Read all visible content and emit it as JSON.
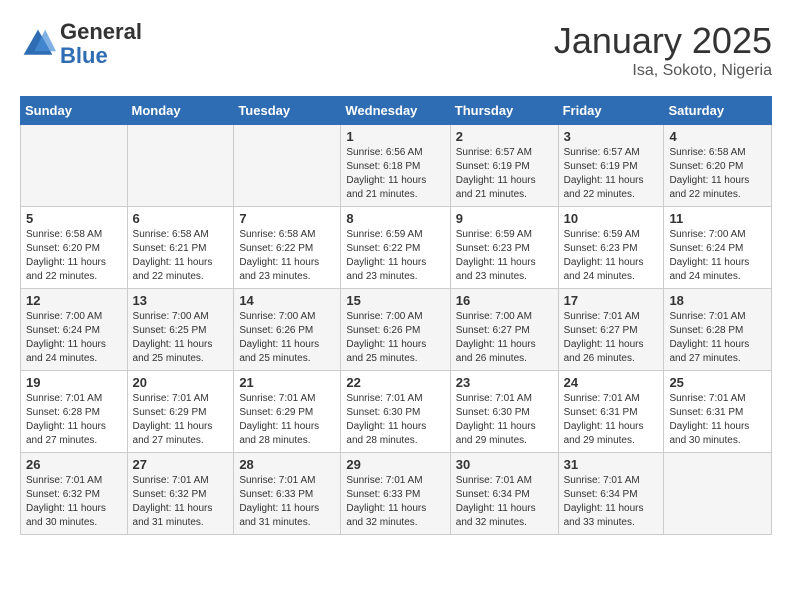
{
  "header": {
    "logo_general": "General",
    "logo_blue": "Blue",
    "month": "January 2025",
    "location": "Isa, Sokoto, Nigeria"
  },
  "days_of_week": [
    "Sunday",
    "Monday",
    "Tuesday",
    "Wednesday",
    "Thursday",
    "Friday",
    "Saturday"
  ],
  "weeks": [
    [
      {
        "day": "",
        "info": ""
      },
      {
        "day": "",
        "info": ""
      },
      {
        "day": "",
        "info": ""
      },
      {
        "day": "1",
        "info": "Sunrise: 6:56 AM\nSunset: 6:18 PM\nDaylight: 11 hours and 21 minutes."
      },
      {
        "day": "2",
        "info": "Sunrise: 6:57 AM\nSunset: 6:19 PM\nDaylight: 11 hours and 21 minutes."
      },
      {
        "day": "3",
        "info": "Sunrise: 6:57 AM\nSunset: 6:19 PM\nDaylight: 11 hours and 22 minutes."
      },
      {
        "day": "4",
        "info": "Sunrise: 6:58 AM\nSunset: 6:20 PM\nDaylight: 11 hours and 22 minutes."
      }
    ],
    [
      {
        "day": "5",
        "info": "Sunrise: 6:58 AM\nSunset: 6:20 PM\nDaylight: 11 hours and 22 minutes."
      },
      {
        "day": "6",
        "info": "Sunrise: 6:58 AM\nSunset: 6:21 PM\nDaylight: 11 hours and 22 minutes."
      },
      {
        "day": "7",
        "info": "Sunrise: 6:58 AM\nSunset: 6:22 PM\nDaylight: 11 hours and 23 minutes."
      },
      {
        "day": "8",
        "info": "Sunrise: 6:59 AM\nSunset: 6:22 PM\nDaylight: 11 hours and 23 minutes."
      },
      {
        "day": "9",
        "info": "Sunrise: 6:59 AM\nSunset: 6:23 PM\nDaylight: 11 hours and 23 minutes."
      },
      {
        "day": "10",
        "info": "Sunrise: 6:59 AM\nSunset: 6:23 PM\nDaylight: 11 hours and 24 minutes."
      },
      {
        "day": "11",
        "info": "Sunrise: 7:00 AM\nSunset: 6:24 PM\nDaylight: 11 hours and 24 minutes."
      }
    ],
    [
      {
        "day": "12",
        "info": "Sunrise: 7:00 AM\nSunset: 6:24 PM\nDaylight: 11 hours and 24 minutes."
      },
      {
        "day": "13",
        "info": "Sunrise: 7:00 AM\nSunset: 6:25 PM\nDaylight: 11 hours and 25 minutes."
      },
      {
        "day": "14",
        "info": "Sunrise: 7:00 AM\nSunset: 6:26 PM\nDaylight: 11 hours and 25 minutes."
      },
      {
        "day": "15",
        "info": "Sunrise: 7:00 AM\nSunset: 6:26 PM\nDaylight: 11 hours and 25 minutes."
      },
      {
        "day": "16",
        "info": "Sunrise: 7:00 AM\nSunset: 6:27 PM\nDaylight: 11 hours and 26 minutes."
      },
      {
        "day": "17",
        "info": "Sunrise: 7:01 AM\nSunset: 6:27 PM\nDaylight: 11 hours and 26 minutes."
      },
      {
        "day": "18",
        "info": "Sunrise: 7:01 AM\nSunset: 6:28 PM\nDaylight: 11 hours and 27 minutes."
      }
    ],
    [
      {
        "day": "19",
        "info": "Sunrise: 7:01 AM\nSunset: 6:28 PM\nDaylight: 11 hours and 27 minutes."
      },
      {
        "day": "20",
        "info": "Sunrise: 7:01 AM\nSunset: 6:29 PM\nDaylight: 11 hours and 27 minutes."
      },
      {
        "day": "21",
        "info": "Sunrise: 7:01 AM\nSunset: 6:29 PM\nDaylight: 11 hours and 28 minutes."
      },
      {
        "day": "22",
        "info": "Sunrise: 7:01 AM\nSunset: 6:30 PM\nDaylight: 11 hours and 28 minutes."
      },
      {
        "day": "23",
        "info": "Sunrise: 7:01 AM\nSunset: 6:30 PM\nDaylight: 11 hours and 29 minutes."
      },
      {
        "day": "24",
        "info": "Sunrise: 7:01 AM\nSunset: 6:31 PM\nDaylight: 11 hours and 29 minutes."
      },
      {
        "day": "25",
        "info": "Sunrise: 7:01 AM\nSunset: 6:31 PM\nDaylight: 11 hours and 30 minutes."
      }
    ],
    [
      {
        "day": "26",
        "info": "Sunrise: 7:01 AM\nSunset: 6:32 PM\nDaylight: 11 hours and 30 minutes."
      },
      {
        "day": "27",
        "info": "Sunrise: 7:01 AM\nSunset: 6:32 PM\nDaylight: 11 hours and 31 minutes."
      },
      {
        "day": "28",
        "info": "Sunrise: 7:01 AM\nSunset: 6:33 PM\nDaylight: 11 hours and 31 minutes."
      },
      {
        "day": "29",
        "info": "Sunrise: 7:01 AM\nSunset: 6:33 PM\nDaylight: 11 hours and 32 minutes."
      },
      {
        "day": "30",
        "info": "Sunrise: 7:01 AM\nSunset: 6:34 PM\nDaylight: 11 hours and 32 minutes."
      },
      {
        "day": "31",
        "info": "Sunrise: 7:01 AM\nSunset: 6:34 PM\nDaylight: 11 hours and 33 minutes."
      },
      {
        "day": "",
        "info": ""
      }
    ]
  ]
}
